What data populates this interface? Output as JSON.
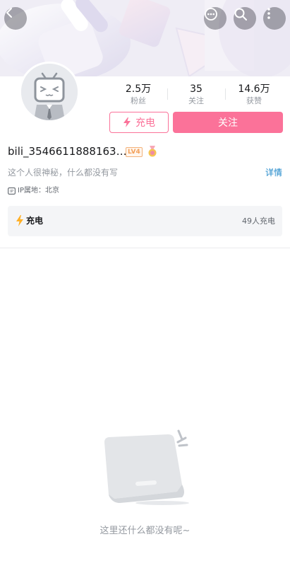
{
  "banner": {
    "back_icon": "chevron-left-icon",
    "message_icon": "message-bubble-icon",
    "search_icon": "search-icon",
    "more_icon": "more-vertical-icon"
  },
  "profile": {
    "avatar_icon": "tv-mascot-avatar-icon",
    "stats": [
      {
        "value": "2.5万",
        "label": "粉丝"
      },
      {
        "value": "35",
        "label": "关注"
      },
      {
        "value": "14.6万",
        "label": "获赞"
      }
    ],
    "charge_label": "充电",
    "follow_label": "关注",
    "username": "bili_3546611888163…",
    "level": "LV4",
    "signature": "这个人很神秘，什么都没有写",
    "details_label": "详情",
    "ip_location": "IP属地：北京"
  },
  "charge_panel": {
    "label": "充电",
    "count": "49人充电"
  },
  "empty_state": {
    "message": "这里还什么都没有呢~"
  },
  "colors": {
    "accent": "#fb7299",
    "link": "#1a85c8",
    "lightning": "#ffb027"
  }
}
